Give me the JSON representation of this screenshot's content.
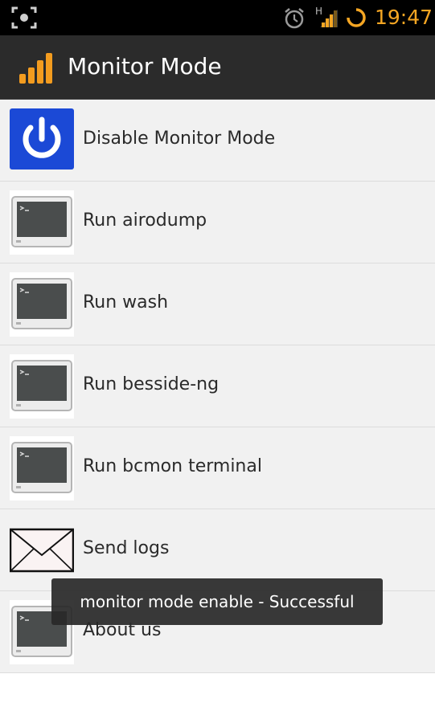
{
  "status_bar": {
    "time": "19:47",
    "network_label": "H",
    "icons": [
      "screenshot-icon",
      "alarm-icon",
      "signal-icon",
      "sync-icon"
    ],
    "time_color": "#f5a623"
  },
  "app_bar": {
    "title": "Monitor Mode",
    "icon": "signal-bars-icon",
    "icon_color": "#f39c1f",
    "background": "#2b2b2b"
  },
  "menu": {
    "items": [
      {
        "label": "Disable Monitor Mode",
        "icon": "power-icon"
      },
      {
        "label": "Run airodump",
        "icon": "terminal-icon"
      },
      {
        "label": "Run wash",
        "icon": "terminal-icon"
      },
      {
        "label": "Run besside-ng",
        "icon": "terminal-icon"
      },
      {
        "label": "Run bcmon terminal",
        "icon": "terminal-icon"
      },
      {
        "label": "Send logs",
        "icon": "envelope-icon"
      },
      {
        "label": "About us",
        "icon": "terminal-icon"
      }
    ]
  },
  "toast": {
    "message": "monitor mode enable - Successful"
  }
}
